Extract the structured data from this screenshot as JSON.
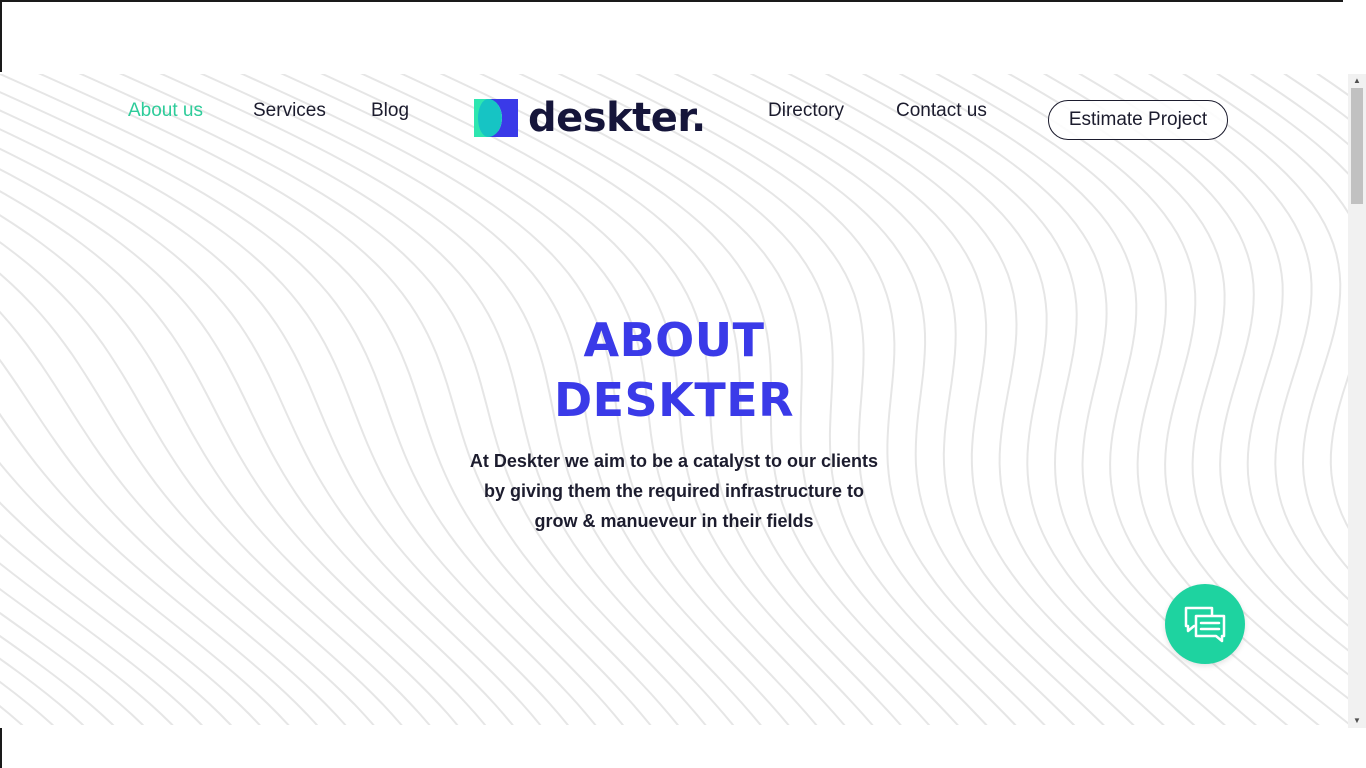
{
  "nav": {
    "left_links": [
      "About us",
      "Services",
      "Blog"
    ],
    "right_links": [
      "Directory",
      "Contact us"
    ],
    "active": "About us"
  },
  "logo": {
    "text": "deskter.",
    "icon": "deskter-logo-mark"
  },
  "cta": {
    "label": "Estimate Project"
  },
  "hero": {
    "title_line1": "ABOUT",
    "title_line2": "DESKTER",
    "text_line1": "At Deskter we aim to be a catalyst to our clients",
    "text_line2": "by giving them the required infrastructure to",
    "text_line3": "grow & manueveur in their fields"
  },
  "chat": {
    "icon": "chat-bubbles-icon"
  },
  "colors": {
    "accent_green": "#2ecc9a",
    "chat_green": "#1ed3a0",
    "title_blue": "#3a3ae8",
    "dark_text": "#1c1c2e",
    "logo_dark": "#15153a"
  }
}
